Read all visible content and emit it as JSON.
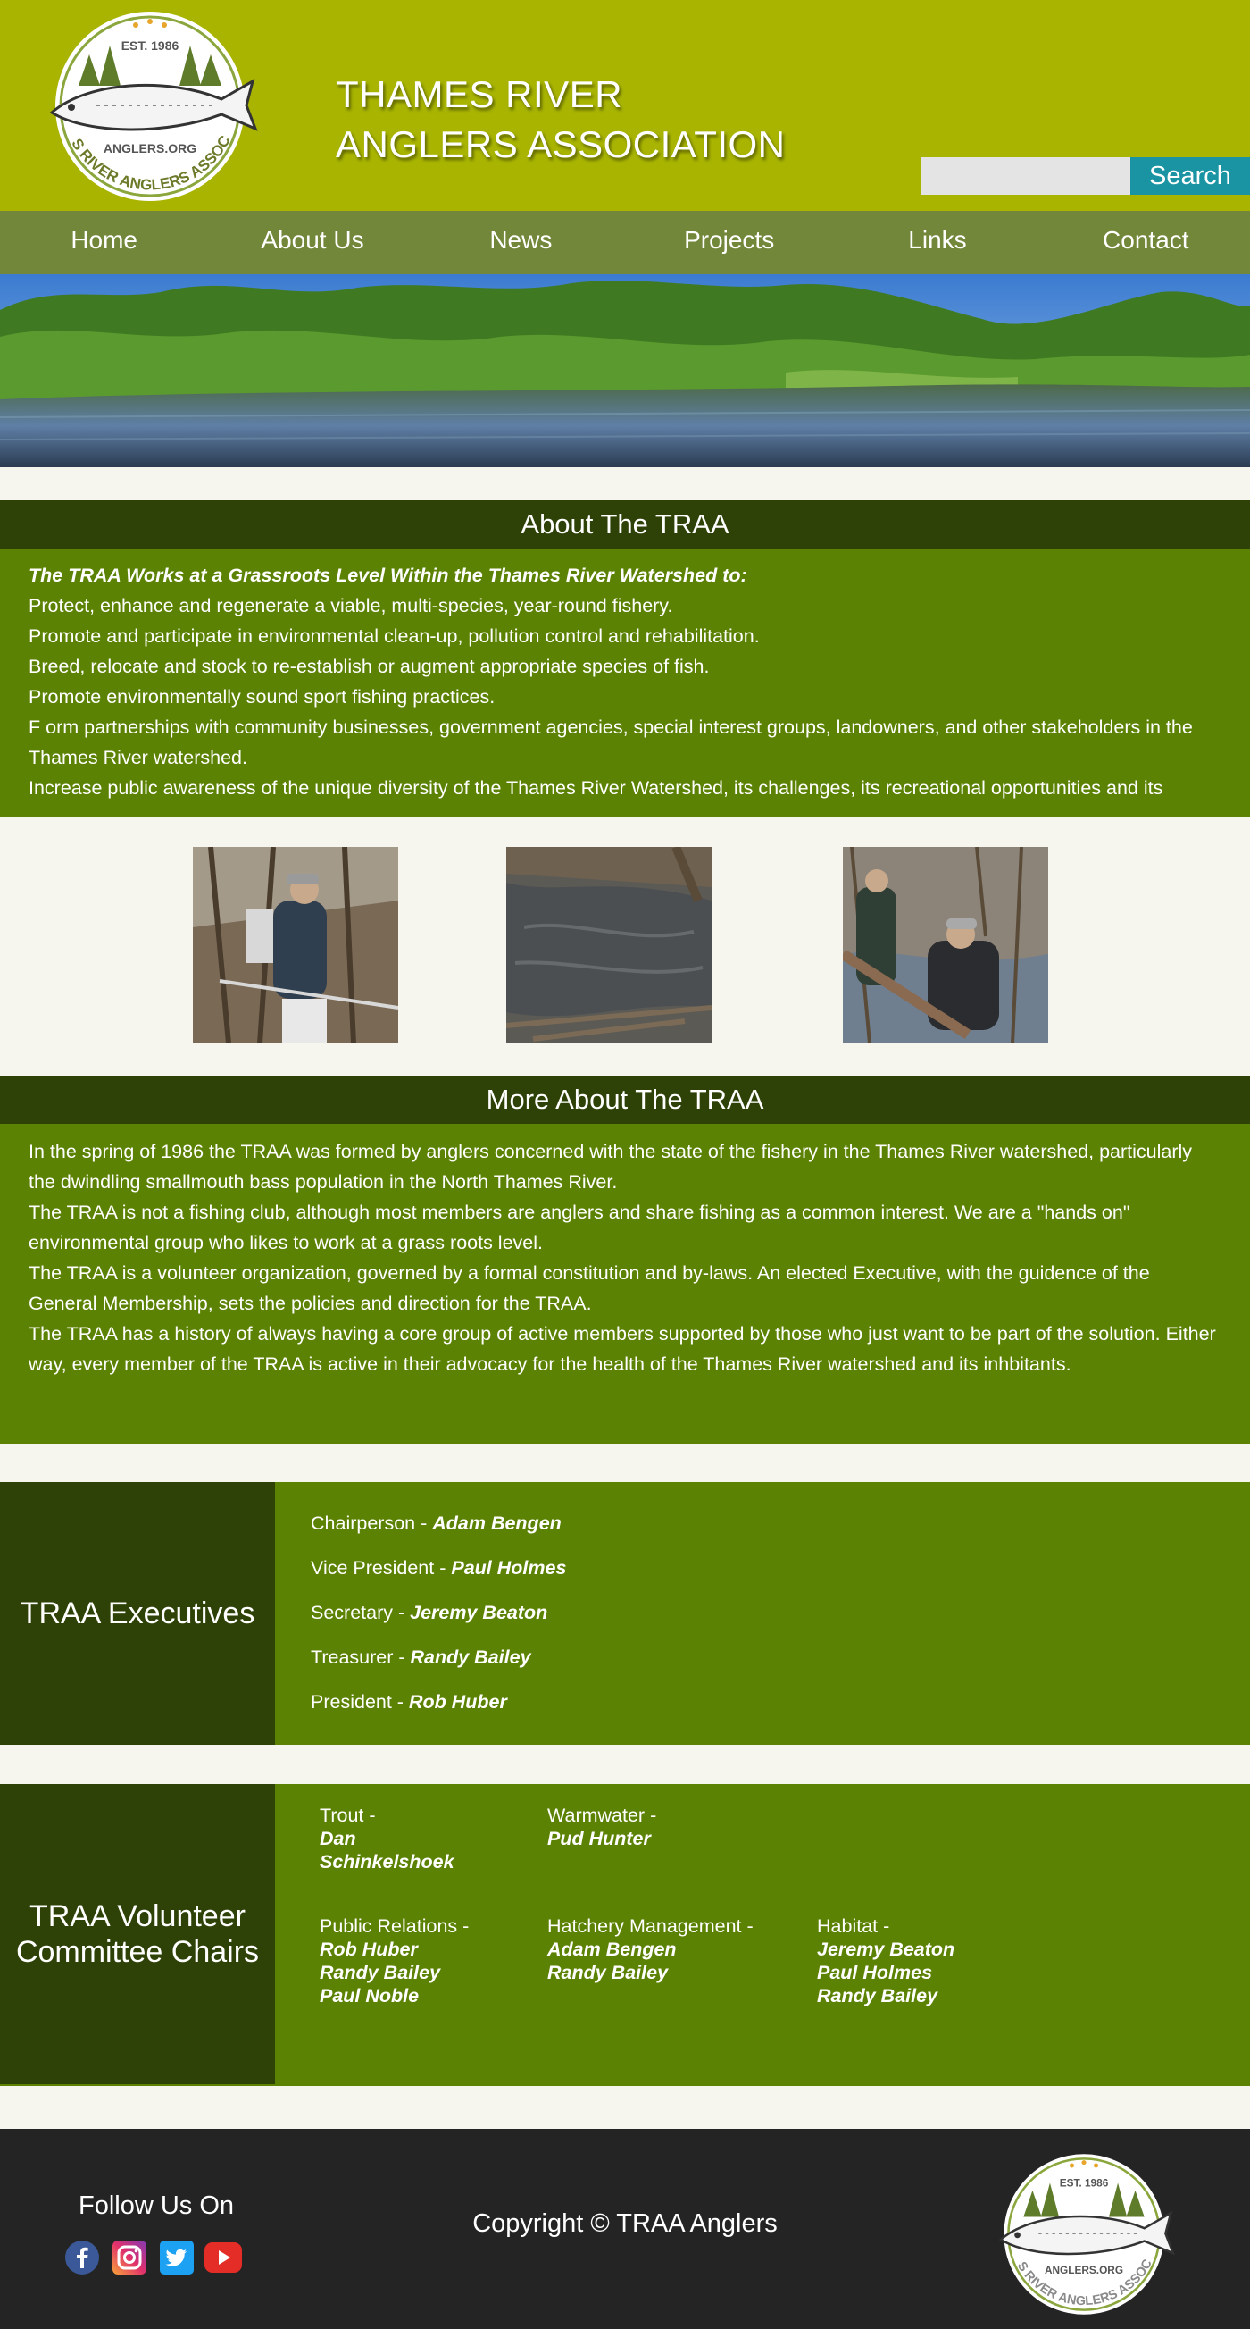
{
  "header": {
    "logo_est": "EST. 1986",
    "logo_url_text": "ANGLERS.ORG",
    "logo_ring_text": "THAMES RIVER ANGLERS ASSOCIATION",
    "title_line1": "THAMES RIVER",
    "title_line2": "ANGLERS ASSOCIATION",
    "search_placeholder": "",
    "search_label": "Search"
  },
  "nav": [
    "Home",
    "About Us",
    "News",
    "Projects",
    "Links",
    "Contact"
  ],
  "about": {
    "heading": "About The TRAA",
    "intro": "The TRAA Works at a Grassroots Level Within the Thames River Watershed to:",
    "items": [
      "Protect, enhance and regenerate a viable, multi-species, year-round fishery.",
      "Promote and participate in environmental clean-up, pollution control and rehabilitation.",
      "Breed, relocate and stock to re-establish or augment appropriate species of fish.",
      "Promote environmentally sound sport fishing practices.",
      "F orm partnerships with community businesses, government agencies, special interest groups, landowners, and other stakeholders in the Thames River watershed.",
      "Increase public awareness of the unique diversity of the Thames River Watershed, its challenges, its recreational opportunities and its"
    ]
  },
  "more_about": {
    "heading": "More About The TRAA",
    "paragraphs": [
      "In the spring of 1986 the TRAA was formed by anglers concerned with the state of the fishery in the Thames River watershed, particularly the dwindling smallmouth bass population in the North Thames River.",
      "The TRAA is not a fishing club, although most members are anglers and share fishing as a common interest. We are a \"hands on\" environmental group who likes to work at a grass roots level.",
      "The TRAA is a volunteer organization, governed by a formal constitution and by-laws. An elected Executive, with the guidence of the General Membership, sets the policies and direction for the TRAA.",
      "The TRAA has a history of always having a core group of active members supported by those who just want to be part of the solution. Either way, every member of the TRAA is active in their advocacy for the health of the Thames River watershed and its inhbitants."
    ]
  },
  "executives": {
    "heading": "TRAA Executives",
    "rows": [
      {
        "role": "Chairperson - ",
        "name": "Adam Bengen"
      },
      {
        "role": "Vice President - ",
        "name": "Paul Holmes"
      },
      {
        "role": "Secretary - ",
        "name": "Jeremy Beaton"
      },
      {
        "role": "Treasurer - ",
        "name": "Randy Bailey"
      },
      {
        "role": "President - ",
        "name": "Rob Huber"
      }
    ]
  },
  "committees": {
    "heading_line1": "TRAA Volunteer",
    "heading_line2": "Committee Chairs",
    "items": [
      {
        "role": "Trout -",
        "names": [
          "Dan",
          "Schinkelshoek"
        ]
      },
      {
        "role": "Warmwater -",
        "names": [
          "Pud Hunter"
        ]
      },
      {
        "role": "Public Relations -",
        "names": [
          "Rob Huber",
          "Randy Bailey",
          "Paul Noble"
        ]
      },
      {
        "role": "Hatchery Management -",
        "names": [
          "Adam Bengen",
          "Randy Bailey"
        ]
      },
      {
        "role": "Habitat -",
        "names": [
          "Jeremy Beaton",
          "Paul Holmes",
          "Randy Bailey"
        ]
      }
    ]
  },
  "footer": {
    "follow": "Follow Us On",
    "social": [
      "facebook-icon",
      "instagram-icon",
      "twitter-icon",
      "youtube-icon"
    ],
    "copyright": "Copyright © TRAA Anglers"
  },
  "colors": {
    "header_bg": "#a8b400",
    "nav_bg": "#72873a",
    "section_dark": "#2e4207",
    "section_green": "#5c8204",
    "search_button": "#1a94a3",
    "footer_bg": "#242424",
    "page_bg": "#f6f6ee"
  }
}
